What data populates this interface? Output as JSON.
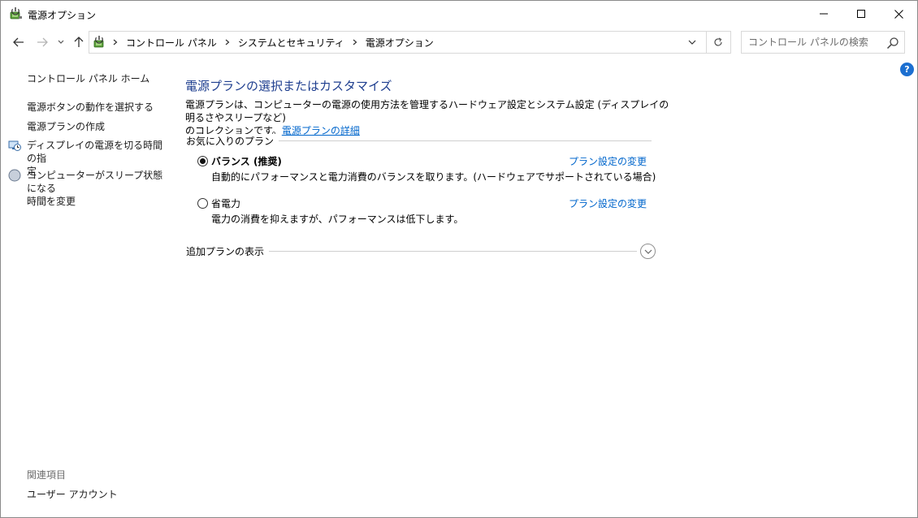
{
  "window": {
    "title": "電源オプション"
  },
  "address": {
    "breadcrumbs": [
      "コントロール パネル",
      "システムとセキュリティ",
      "電源オプション"
    ]
  },
  "search": {
    "placeholder": "コントロール パネルの検索"
  },
  "help": {
    "label": "?"
  },
  "sidebar": {
    "home": "コントロール パネル ホーム",
    "links": [
      {
        "label": "電源ボタンの動作を選択する"
      },
      {
        "label": "電源プランの作成"
      },
      {
        "label_line1": "ディスプレイの電源を切る時間の指",
        "label_line2": "定",
        "icon": "monitor-clock-icon"
      },
      {
        "label_line1": "コンピューターがスリープ状態になる",
        "label_line2": "時間を変更",
        "icon": "moon-icon"
      }
    ],
    "related_heading": "関連項目",
    "related_links": [
      "ユーザー アカウント"
    ]
  },
  "main": {
    "title": "電源プランの選択またはカスタマイズ",
    "description_line1": "電源プランは、コンピューターの電源の使用方法を管理するハードウェア設定とシステム設定 (ディスプレイの明るさやスリープなど)",
    "description_line2_prefix": "のコレクションです。",
    "description_link": "電源プランの詳細",
    "favorites_label": "お気に入りのプラン",
    "plans": [
      {
        "name": "バランス (推奨)",
        "description": "自動的にパフォーマンスと電力消費のバランスを取ります。(ハードウェアでサポートされている場合)",
        "link": "プラン設定の変更",
        "selected": true
      },
      {
        "name": "省電力",
        "description": "電力の消費を抑えますが、パフォーマンスは低下します。",
        "link": "プラン設定の変更",
        "selected": false
      }
    ],
    "additional_label": "追加プランの表示"
  },
  "colors": {
    "title_blue": "#1e3e8f",
    "link_blue": "#0066cc",
    "help_blue": "#1c6fd0"
  }
}
